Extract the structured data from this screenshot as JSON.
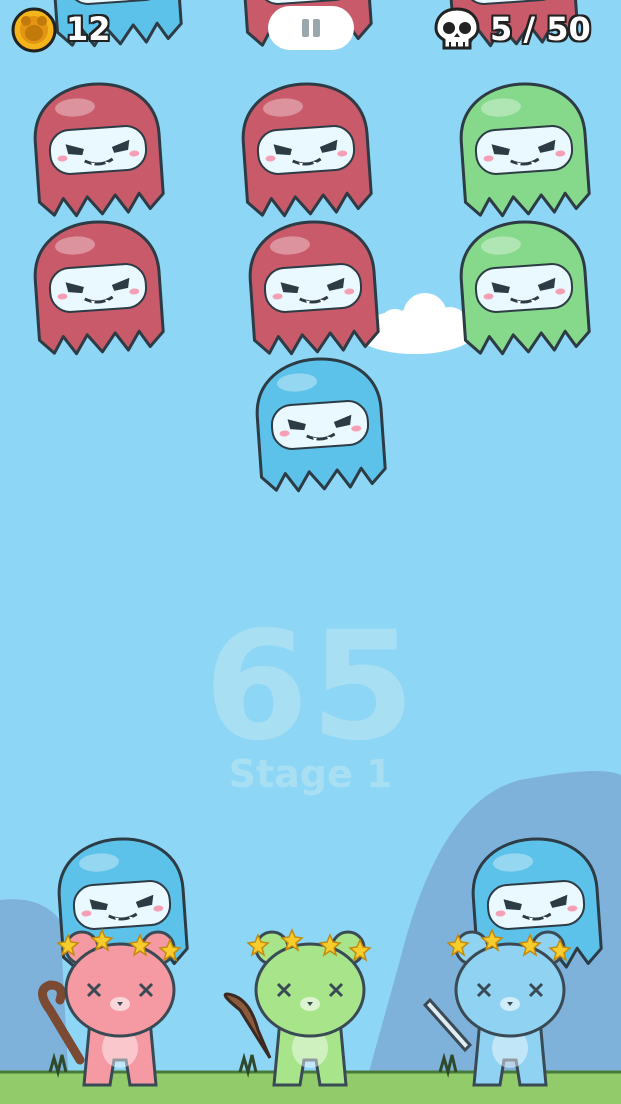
{
  "hud": {
    "coins": "12",
    "kills": "5 / 50",
    "coin_icon": "bear-coin-icon",
    "kill_icon": "skull-icon",
    "pause_icon": "pause-icon"
  },
  "center": {
    "countdown": "65",
    "stage": "Stage 1"
  },
  "colors": {
    "sky": "#8ed6f6",
    "ghost_red": "#c95a6a",
    "ghost_green": "#86d98b",
    "ghost_blue": "#5cc2ea",
    "bear_pink": "#f59aa2",
    "bear_green": "#a8e58a",
    "bear_blue": "#8fd2f2",
    "grass": "#92cc6a"
  },
  "scene": {
    "ghosts": [
      {
        "color": "blue"
      },
      {
        "color": "red"
      },
      {
        "color": "red"
      },
      {
        "color": "red"
      },
      {
        "color": "red"
      },
      {
        "color": "green"
      },
      {
        "color": "red"
      },
      {
        "color": "red"
      },
      {
        "color": "green"
      },
      {
        "color": "blue"
      },
      {
        "color": "blue"
      },
      {
        "color": "blue"
      }
    ],
    "bears": [
      {
        "color": "pink",
        "weapon": "cane"
      },
      {
        "color": "green",
        "weapon": "club"
      },
      {
        "color": "blue",
        "weapon": "sword"
      }
    ]
  }
}
